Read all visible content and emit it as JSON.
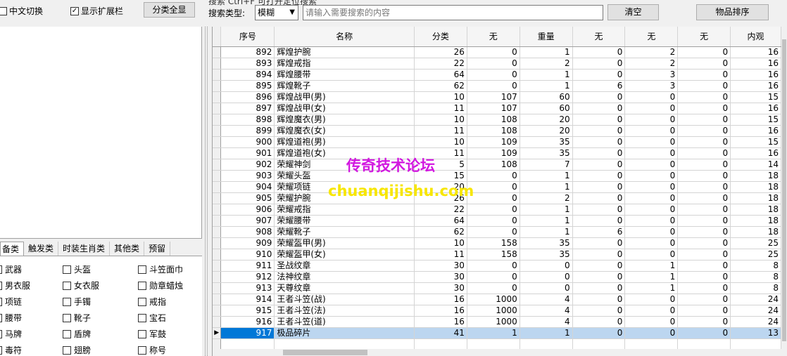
{
  "toolbar": {
    "chinese_switch": "中文切换",
    "show_ext": "显示扩展栏",
    "show_ext_checked": "✓",
    "category_all": "分类全显",
    "search_hint": "搜索 Ctrl+F 可打开定位搜索",
    "search_type_label": "搜索类型:",
    "search_type_value": "模糊",
    "search_placeholder": "请输入需要搜索的内容",
    "clear": "清空",
    "sort": "物品排序"
  },
  "tabs": [
    "备类",
    "触发类",
    "时装生肖类",
    "其他类",
    "预留"
  ],
  "checkboxes": {
    "col1": [
      "武器",
      "男衣服",
      "项链",
      "腰带",
      "马牌",
      "毒符"
    ],
    "col2": [
      "头盔",
      "女衣服",
      "手镯",
      "靴子",
      "盾牌",
      "翅膀"
    ],
    "col3": [
      "斗笠面巾",
      "勋章蜡烛",
      "戒指",
      "宝石",
      "军鼓",
      "称号"
    ]
  },
  "grid": {
    "columns": [
      "序号",
      "名称",
      "分类",
      "无",
      "重量",
      "无",
      "无",
      "无",
      "内观"
    ],
    "rows": [
      [
        "892",
        "辉煌护腕",
        "26",
        "0",
        "1",
        "0",
        "2",
        "0",
        "16"
      ],
      [
        "893",
        "辉煌戒指",
        "22",
        "0",
        "2",
        "0",
        "2",
        "0",
        "16"
      ],
      [
        "894",
        "辉煌腰带",
        "64",
        "0",
        "1",
        "0",
        "3",
        "0",
        "16"
      ],
      [
        "895",
        "辉煌靴子",
        "62",
        "0",
        "1",
        "6",
        "3",
        "0",
        "16"
      ],
      [
        "896",
        "辉煌战甲(男)",
        "10",
        "107",
        "60",
        "0",
        "0",
        "0",
        "15"
      ],
      [
        "897",
        "辉煌战甲(女)",
        "11",
        "107",
        "60",
        "0",
        "0",
        "0",
        "16"
      ],
      [
        "898",
        "辉煌魔衣(男)",
        "10",
        "108",
        "20",
        "0",
        "0",
        "0",
        "15"
      ],
      [
        "899",
        "辉煌魔衣(女)",
        "11",
        "108",
        "20",
        "0",
        "0",
        "0",
        "16"
      ],
      [
        "900",
        "辉煌道袍(男)",
        "10",
        "109",
        "35",
        "0",
        "0",
        "0",
        "15"
      ],
      [
        "901",
        "辉煌道袍(女)",
        "11",
        "109",
        "35",
        "0",
        "0",
        "0",
        "16"
      ],
      [
        "902",
        "荣耀神剑",
        "5",
        "108",
        "7",
        "0",
        "0",
        "0",
        "14"
      ],
      [
        "903",
        "荣耀头盔",
        "15",
        "0",
        "1",
        "0",
        "0",
        "0",
        "18"
      ],
      [
        "904",
        "荣耀项链",
        "20",
        "0",
        "1",
        "0",
        "0",
        "0",
        "18"
      ],
      [
        "905",
        "荣耀护腕",
        "26",
        "0",
        "2",
        "0",
        "0",
        "0",
        "18"
      ],
      [
        "906",
        "荣耀戒指",
        "22",
        "0",
        "1",
        "0",
        "0",
        "0",
        "18"
      ],
      [
        "907",
        "荣耀腰带",
        "64",
        "0",
        "1",
        "0",
        "0",
        "0",
        "18"
      ],
      [
        "908",
        "荣耀靴子",
        "62",
        "0",
        "1",
        "6",
        "0",
        "0",
        "18"
      ],
      [
        "909",
        "荣耀盔甲(男)",
        "10",
        "158",
        "35",
        "0",
        "0",
        "0",
        "25"
      ],
      [
        "910",
        "荣耀盔甲(女)",
        "11",
        "158",
        "35",
        "0",
        "0",
        "0",
        "25"
      ],
      [
        "911",
        "圣战纹章",
        "30",
        "0",
        "0",
        "0",
        "1",
        "0",
        "8"
      ],
      [
        "912",
        "法神纹章",
        "30",
        "0",
        "0",
        "0",
        "1",
        "0",
        "8"
      ],
      [
        "913",
        "天尊纹章",
        "30",
        "0",
        "0",
        "0",
        "1",
        "0",
        "8"
      ],
      [
        "914",
        "王者斗笠(战)",
        "16",
        "1000",
        "4",
        "0",
        "0",
        "0",
        "24"
      ],
      [
        "915",
        "王者斗笠(法)",
        "16",
        "1000",
        "4",
        "0",
        "0",
        "0",
        "24"
      ],
      [
        "916",
        "王者斗笠(道)",
        "16",
        "1000",
        "4",
        "0",
        "0",
        "0",
        "24"
      ],
      [
        "917",
        "极品碎片",
        "41",
        "1",
        "1",
        "0",
        "0",
        "0",
        "13"
      ]
    ],
    "selected_index": 25,
    "selected_marker": "▶"
  },
  "watermark": {
    "line1": "传奇技术论坛",
    "line2": "chuanqijishu.com",
    "color1": "#d218e0",
    "color2": "#f7e600"
  }
}
